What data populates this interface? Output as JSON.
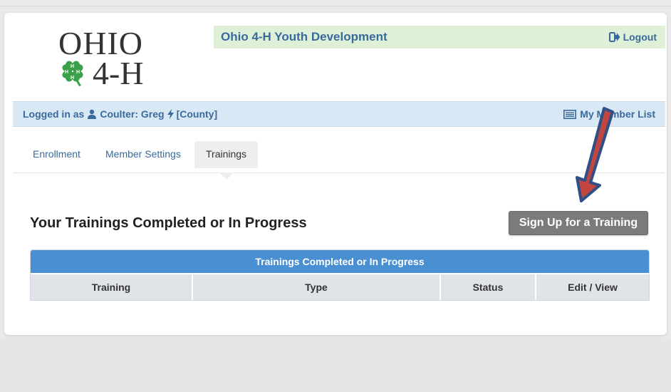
{
  "brand": {
    "logo_line1": "OHIO",
    "logo_line2": "4-H",
    "site_title": "Ohio 4-H Youth Development",
    "logout_label": "Logout",
    "accent": "#3a6a9c",
    "clover_color": "#3aa04a"
  },
  "info_bar": {
    "logged_in_prefix": "Logged in as",
    "user_name": "Coulter: Greg",
    "county_label": "[County]",
    "member_list_label": "My Member List"
  },
  "tabs": [
    {
      "label": "Enrollment",
      "active": false
    },
    {
      "label": "Member Settings",
      "active": false
    },
    {
      "label": "Trainings",
      "active": true
    }
  ],
  "main": {
    "section_title": "Your Trainings Completed or In Progress",
    "signup_button": "Sign Up for a Training",
    "table": {
      "caption": "Trainings Completed or In Progress",
      "columns": [
        "Training",
        "Type",
        "Status",
        "Edit / View"
      ],
      "rows": []
    }
  },
  "annotation": {
    "arrow_color": "#c0463f",
    "arrow_outline": "#2f4f86"
  }
}
